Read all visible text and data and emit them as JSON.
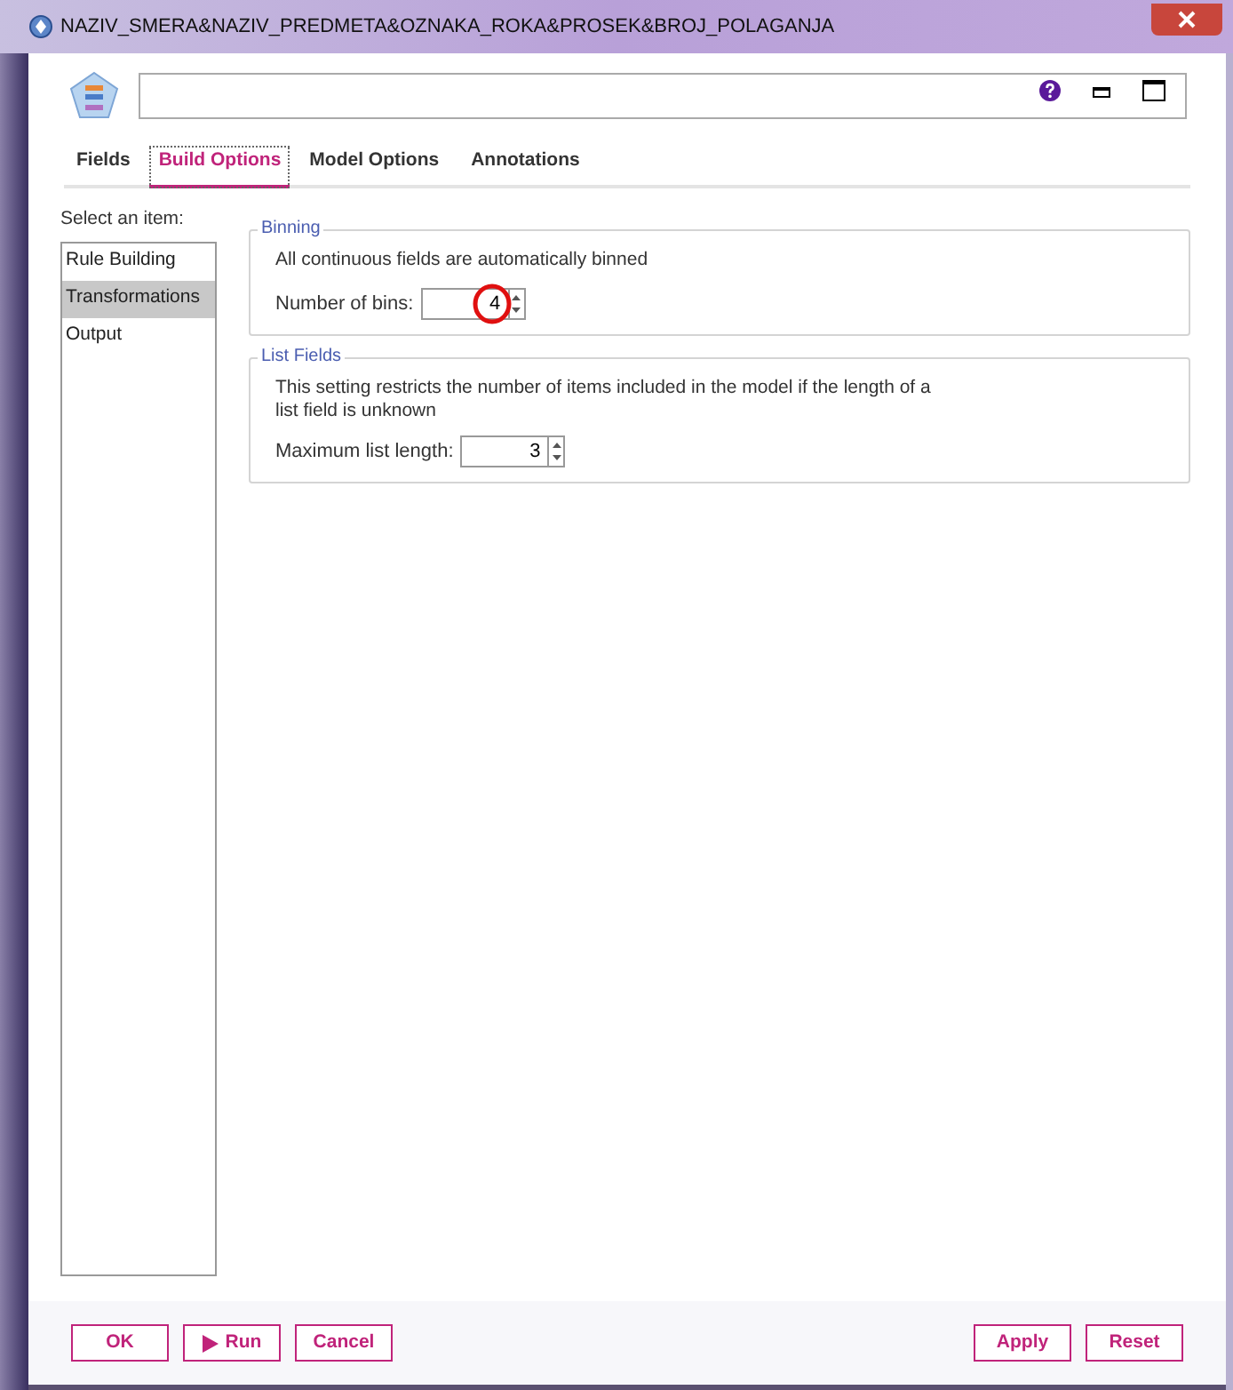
{
  "window": {
    "title": "NAZIV_SMERA&NAZIV_PREDMETA&OZNAKA_ROKA&PROSEK&BROJ_POLAGANJA"
  },
  "tabs": [
    {
      "label": "Fields",
      "selected": false
    },
    {
      "label": "Build Options",
      "selected": true
    },
    {
      "label": "Model Options",
      "selected": false
    },
    {
      "label": "Annotations",
      "selected": false
    }
  ],
  "sidebar": {
    "label": "Select an item:",
    "items": [
      {
        "label": "Rule Building",
        "selected": false
      },
      {
        "label": "Transformations",
        "selected": true
      },
      {
        "label": "Output",
        "selected": false
      }
    ]
  },
  "binning": {
    "title": "Binning",
    "description": "All continuous fields are automatically binned",
    "field_label": "Number of bins:",
    "value": "4",
    "highlighted": true
  },
  "list_fields": {
    "title": "List Fields",
    "description": "This setting restricts the number of items included in the model if the length of a list field is unknown",
    "field_label": "Maximum list length:",
    "value": "3"
  },
  "buttons_left": [
    "OK",
    "Run",
    "Cancel"
  ],
  "buttons_right": [
    "Apply",
    "Reset"
  ]
}
